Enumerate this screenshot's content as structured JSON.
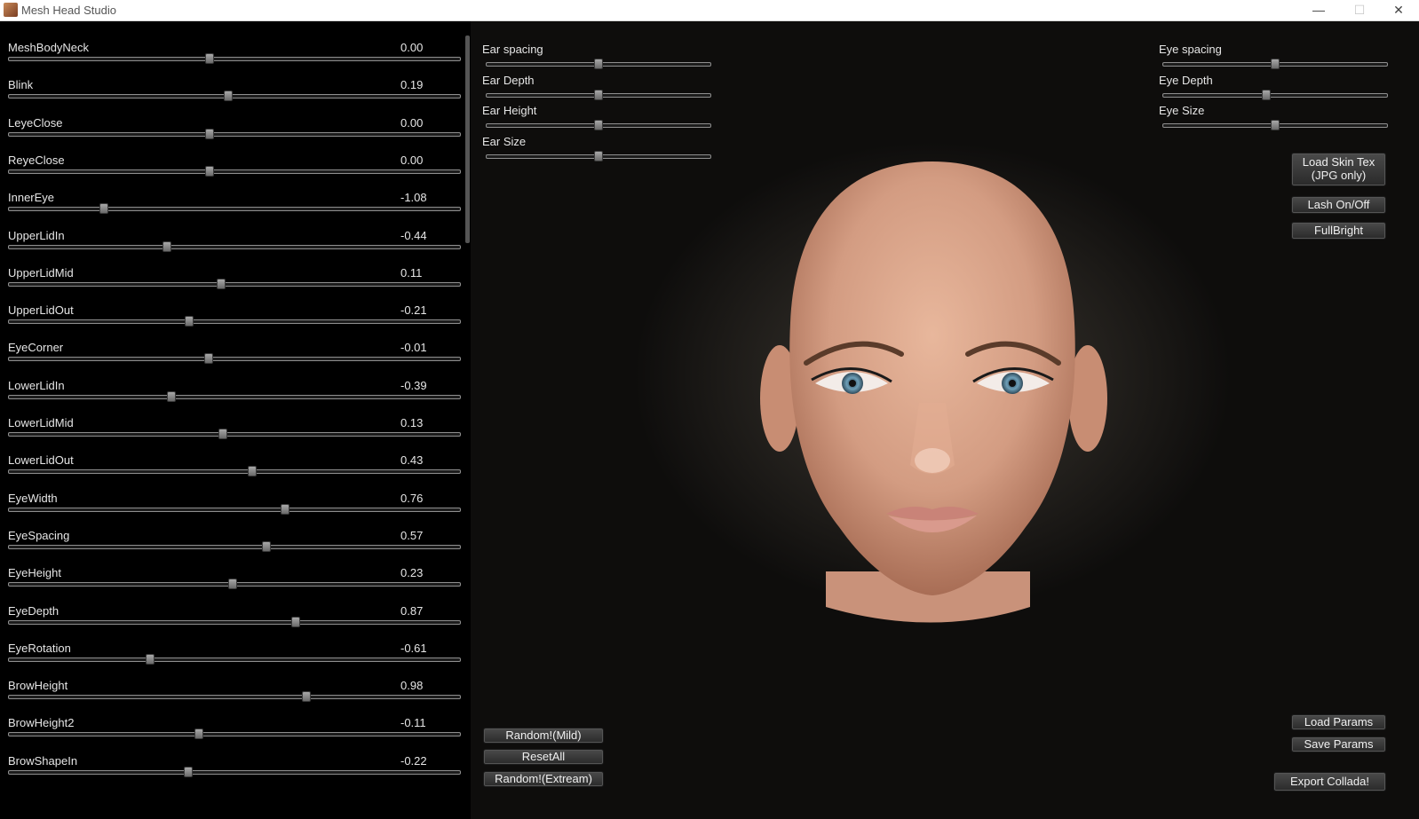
{
  "window": {
    "title": "Mesh Head Studio",
    "minimize": "—",
    "maximize": "☐",
    "close": "✕"
  },
  "params": [
    {
      "label": "MeshBodyNeck",
      "value": "0.00",
      "level": 0.445
    },
    {
      "label": "Blink",
      "value": "0.19",
      "level": 0.487
    },
    {
      "label": "LeyeClose",
      "value": "0.00",
      "level": 0.445
    },
    {
      "label": "ReyeClose",
      "value": "0.00",
      "level": 0.445
    },
    {
      "label": "InnerEye",
      "value": "-1.08",
      "level": 0.21
    },
    {
      "label": "UpperLidIn",
      "value": "-0.44",
      "level": 0.35
    },
    {
      "label": "UpperLidMid",
      "value": "0.11",
      "level": 0.47
    },
    {
      "label": "UpperLidOut",
      "value": "-0.21",
      "level": 0.4
    },
    {
      "label": "EyeCorner",
      "value": "-0.01",
      "level": 0.443
    },
    {
      "label": "LowerLidIn",
      "value": "-0.39",
      "level": 0.36
    },
    {
      "label": "LowerLidMid",
      "value": "0.13",
      "level": 0.474
    },
    {
      "label": "LowerLidOut",
      "value": "0.43",
      "level": 0.54
    },
    {
      "label": "EyeWidth",
      "value": "0.76",
      "level": 0.612
    },
    {
      "label": "EyeSpacing",
      "value": "0.57",
      "level": 0.571
    },
    {
      "label": "EyeHeight",
      "value": "0.23",
      "level": 0.496
    },
    {
      "label": "EyeDepth",
      "value": "0.87",
      "level": 0.636
    },
    {
      "label": "EyeRotation",
      "value": "-0.61",
      "level": 0.313
    },
    {
      "label": "BrowHeight",
      "value": "0.98",
      "level": 0.66
    },
    {
      "label": "BrowHeight2",
      "value": "-0.11",
      "level": 0.421
    },
    {
      "label": "BrowShapeIn",
      "value": "-0.22",
      "level": 0.397
    }
  ],
  "ear_controls": [
    {
      "label": "Ear spacing",
      "level": 0.5
    },
    {
      "label": "Ear Depth",
      "level": 0.5
    },
    {
      "label": "Ear Height",
      "level": 0.5
    },
    {
      "label": "Ear Size",
      "level": 0.5
    }
  ],
  "eye_controls": [
    {
      "label": "Eye spacing",
      "level": 0.5
    },
    {
      "label": "Eye Depth",
      "level": 0.46
    },
    {
      "label": "Eye Size",
      "level": 0.5
    }
  ],
  "buttons": {
    "load_skin_line1": "Load Skin Tex",
    "load_skin_line2": "(JPG only)",
    "lash": "Lash On/Off",
    "fullbright": "FullBright",
    "random_mild": "Random!(Mild)",
    "reset_all": "ResetAll",
    "random_extream": "Random!(Extream)",
    "load_params": "Load Params",
    "save_params": "Save Params",
    "export": "Export Collada!"
  }
}
